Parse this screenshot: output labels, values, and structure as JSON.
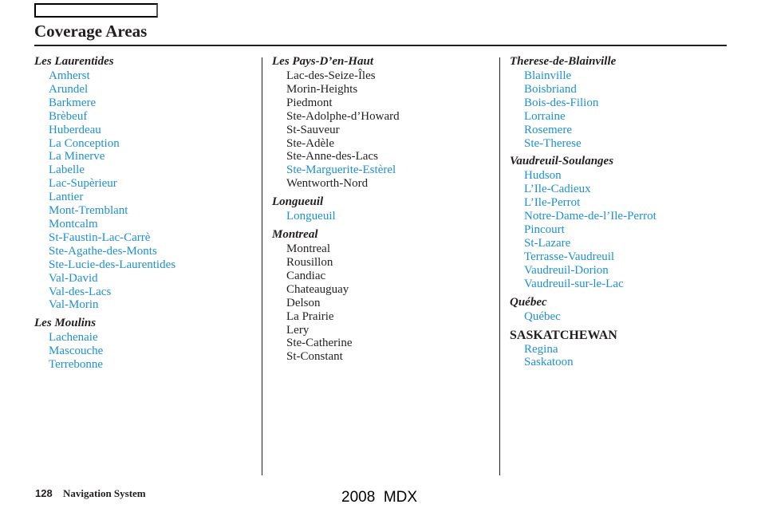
{
  "page": {
    "title": "Coverage Areas",
    "colors": {
      "linked": "#1e8fd6",
      "text": "#231f20"
    }
  },
  "columns": [
    {
      "groups": [
        {
          "heading": "Les Laurentides",
          "cities": [
            {
              "name": "Amherst",
              "linked": true
            },
            {
              "name": "Arundel",
              "linked": true
            },
            {
              "name": "Barkmere",
              "linked": true
            },
            {
              "name": "Brèbeuf",
              "linked": true
            },
            {
              "name": "Huberdeau",
              "linked": true
            },
            {
              "name": "La Conception",
              "linked": true
            },
            {
              "name": "La Minerve",
              "linked": true
            },
            {
              "name": "Labelle",
              "linked": true
            },
            {
              "name": "Lac-Supèrieur",
              "linked": true
            },
            {
              "name": "Lantier",
              "linked": true
            },
            {
              "name": "Mont-Tremblant",
              "linked": true
            },
            {
              "name": "Montcalm",
              "linked": true
            },
            {
              "name": "St-Faustin-Lac-Carrè",
              "linked": true
            },
            {
              "name": "Ste-Agathe-des-Monts",
              "linked": true
            },
            {
              "name": "Ste-Lucie-des-Laurentides",
              "linked": true
            },
            {
              "name": "Val-David",
              "linked": true
            },
            {
              "name": "Val-des-Lacs",
              "linked": true
            },
            {
              "name": "Val-Morin",
              "linked": true
            }
          ]
        },
        {
          "heading": "Les Moulins",
          "cities": [
            {
              "name": "Lachenaie",
              "linked": true
            },
            {
              "name": "Mascouche",
              "linked": true
            },
            {
              "name": "Terrebonne",
              "linked": true
            }
          ]
        }
      ]
    },
    {
      "groups": [
        {
          "heading": "Les Pays-D’en-Haut",
          "cities": [
            {
              "name": "Lac-des-Seize-Îles",
              "linked": false
            },
            {
              "name": "Morin-Heights",
              "linked": false
            },
            {
              "name": "Piedmont",
              "linked": false
            },
            {
              "name": "Ste-Adolphe-d’Howard",
              "linked": false
            },
            {
              "name": "St-Sauveur",
              "linked": false
            },
            {
              "name": "Ste-Adèle",
              "linked": false
            },
            {
              "name": "Ste-Anne-des-Lacs",
              "linked": false
            },
            {
              "name": "Ste-Marguerite-Estèrel",
              "linked": true
            },
            {
              "name": "Wentworth-Nord",
              "linked": false
            }
          ]
        },
        {
          "heading": "Longueuil",
          "cities": [
            {
              "name": "Longueuil",
              "linked": true
            }
          ]
        },
        {
          "heading": "Montreal",
          "cities": [
            {
              "name": "Montreal",
              "linked": false
            },
            {
              "name": "Rousillon",
              "linked": false
            },
            {
              "name": "Candiac",
              "linked": false
            },
            {
              "name": "Chateauguay",
              "linked": false
            },
            {
              "name": "Delson",
              "linked": false
            },
            {
              "name": "La Prairie",
              "linked": false
            },
            {
              "name": "Lery",
              "linked": false
            },
            {
              "name": "Ste-Catherine",
              "linked": false
            },
            {
              "name": "St-Constant",
              "linked": false
            }
          ]
        }
      ]
    },
    {
      "groups": [
        {
          "heading": "Therese-de-Blainville",
          "cities": [
            {
              "name": "Blainville",
              "linked": true
            },
            {
              "name": "Boisbriand",
              "linked": true
            },
            {
              "name": "Bois-des-Filion",
              "linked": true
            },
            {
              "name": "Lorraine",
              "linked": true
            },
            {
              "name": "Rosemere",
              "linked": true
            },
            {
              "name": "Ste-Therese",
              "linked": true
            }
          ]
        },
        {
          "heading": "Vaudreuil-Soulanges",
          "cities": [
            {
              "name": "Hudson",
              "linked": true
            },
            {
              "name": "L’Ile-Cadieux",
              "linked": true
            },
            {
              "name": "L’Ile-Perrot",
              "linked": true
            },
            {
              "name": "Notre-Dame-de-l’Ile-Perrot",
              "linked": true
            },
            {
              "name": "Pincourt",
              "linked": true
            },
            {
              "name": "St-Lazare",
              "linked": true
            },
            {
              "name": "Terrasse-Vaudreuil",
              "linked": true
            },
            {
              "name": "Vaudreuil-Dorion",
              "linked": true
            },
            {
              "name": "Vaudreuil-sur-le-Lac",
              "linked": true
            }
          ]
        },
        {
          "heading": "Québec",
          "cities": [
            {
              "name": "Québec",
              "linked": true
            }
          ]
        },
        {
          "heading": "SASKATCHEWAN",
          "province": true,
          "cities": [
            {
              "name": "Regina",
              "linked": true
            },
            {
              "name": "Saskatoon",
              "linked": true
            }
          ]
        }
      ]
    }
  ],
  "footer": {
    "page_number": "128",
    "section": "Navigation System",
    "model": "2008  MDX"
  }
}
